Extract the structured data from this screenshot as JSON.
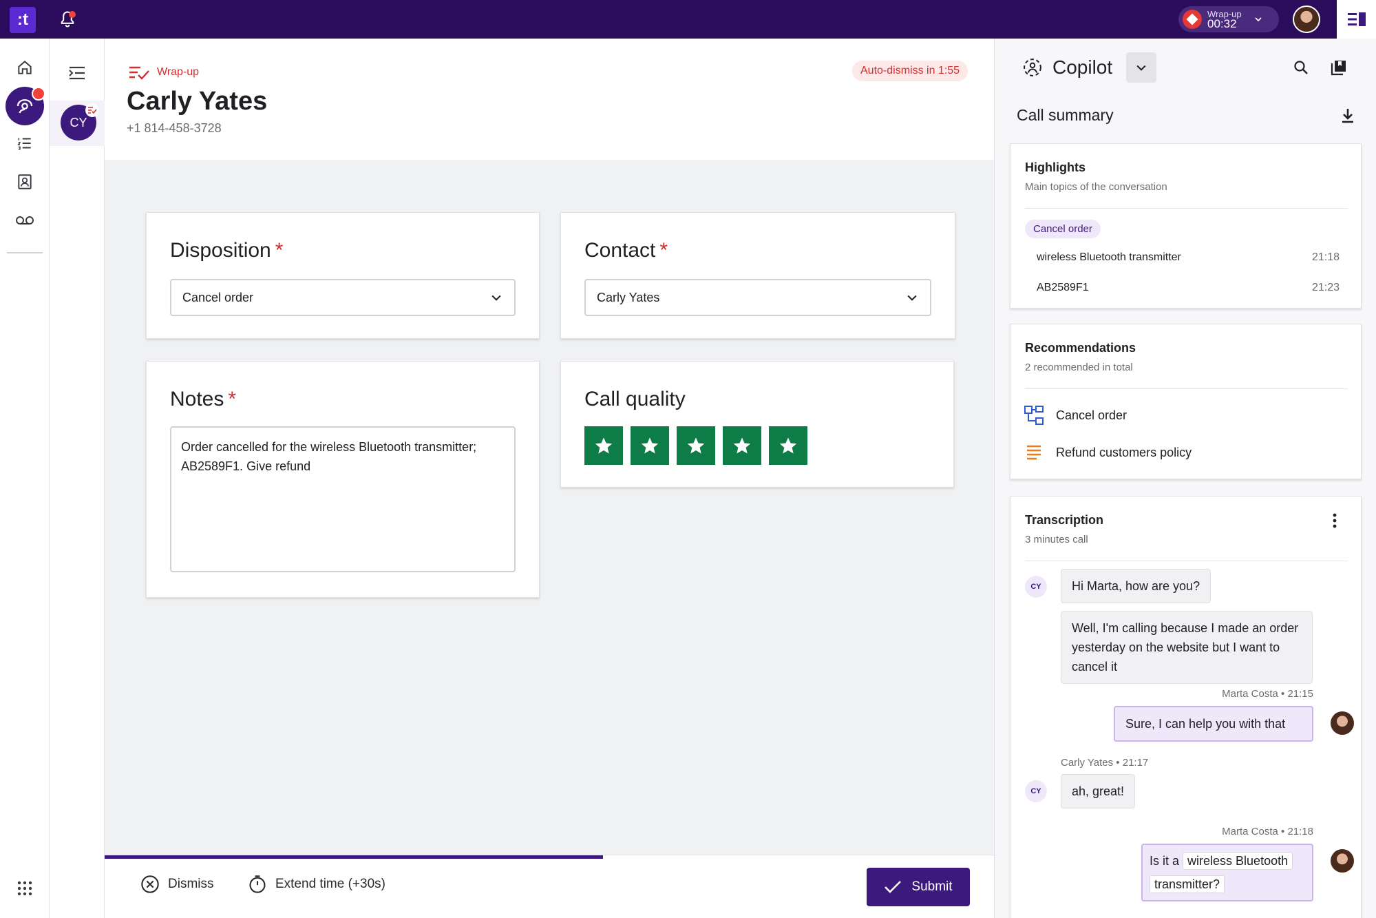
{
  "app": {
    "logo_text": ":t",
    "accent": "#3c1a7d",
    "topbar_color": "#2a0b5c"
  },
  "topbar": {
    "wrap_status": "Wrap-up",
    "wrap_timer": "00:32"
  },
  "rail": {
    "icons": [
      "home-icon",
      "agent-assist-icon",
      "list-icon",
      "contacts-icon",
      "voicemail-icon",
      "apps-grid-icon"
    ]
  },
  "conversation": {
    "initials": "CY"
  },
  "header": {
    "status": "Wrap-up",
    "name": "Carly Yates",
    "phone": "+1 814-458-3728",
    "auto_dismiss": "Auto-dismiss in 1:55"
  },
  "form": {
    "disposition": {
      "label": "Disposition",
      "required": "*",
      "value": "Cancel order"
    },
    "contact": {
      "label": "Contact",
      "required": "*",
      "value": "Carly Yates"
    },
    "notes": {
      "label": "Notes",
      "required": "*",
      "value": "Order cancelled for the wireless Bluetooth transmitter; AB2589F1. Give refund"
    },
    "call_quality": {
      "label": "Call quality",
      "rating": 5,
      "max": 5,
      "star_color": "#0e7c47"
    }
  },
  "footer": {
    "dismiss": "Dismiss",
    "extend": "Extend time (+30s)",
    "submit": "Submit",
    "progress": 0.56
  },
  "copilot": {
    "title": "Copilot",
    "summary_title": "Call summary",
    "highlights": {
      "title": "Highlights",
      "subtitle": "Main topics of the conversation",
      "chip": "Cancel order",
      "items": [
        {
          "text": "wireless Bluetooth transmitter",
          "time": "21:18"
        },
        {
          "text": "AB2589F1",
          "time": "21:23"
        }
      ]
    },
    "recommendations": {
      "title": "Recommendations",
      "subtitle": "2 recommended in total",
      "items": [
        {
          "label": "Cancel order",
          "icon": "workflow-icon"
        },
        {
          "label": "Refund customers policy",
          "icon": "article-icon"
        }
      ]
    },
    "transcription": {
      "title": "Transcription",
      "subtitle": "3 minutes call",
      "messages": [
        {
          "speaker_initials": "CY",
          "text": "Hi Marta, how are you?"
        },
        {
          "text": "Well, I'm calling because I made an order yesterday on the website but I want to cancel it"
        },
        {
          "meta": "Marta Costa • 21:15",
          "text": "Sure, I can help you with that"
        },
        {
          "meta": "Carly Yates • 21:17",
          "speaker_initials": "CY",
          "text": "ah, great!"
        },
        {
          "meta": "Marta Costa • 21:18",
          "text_prefix": "Is it a",
          "tag": "wireless Bluetooth",
          "tag2": "transmitter?"
        }
      ]
    }
  }
}
